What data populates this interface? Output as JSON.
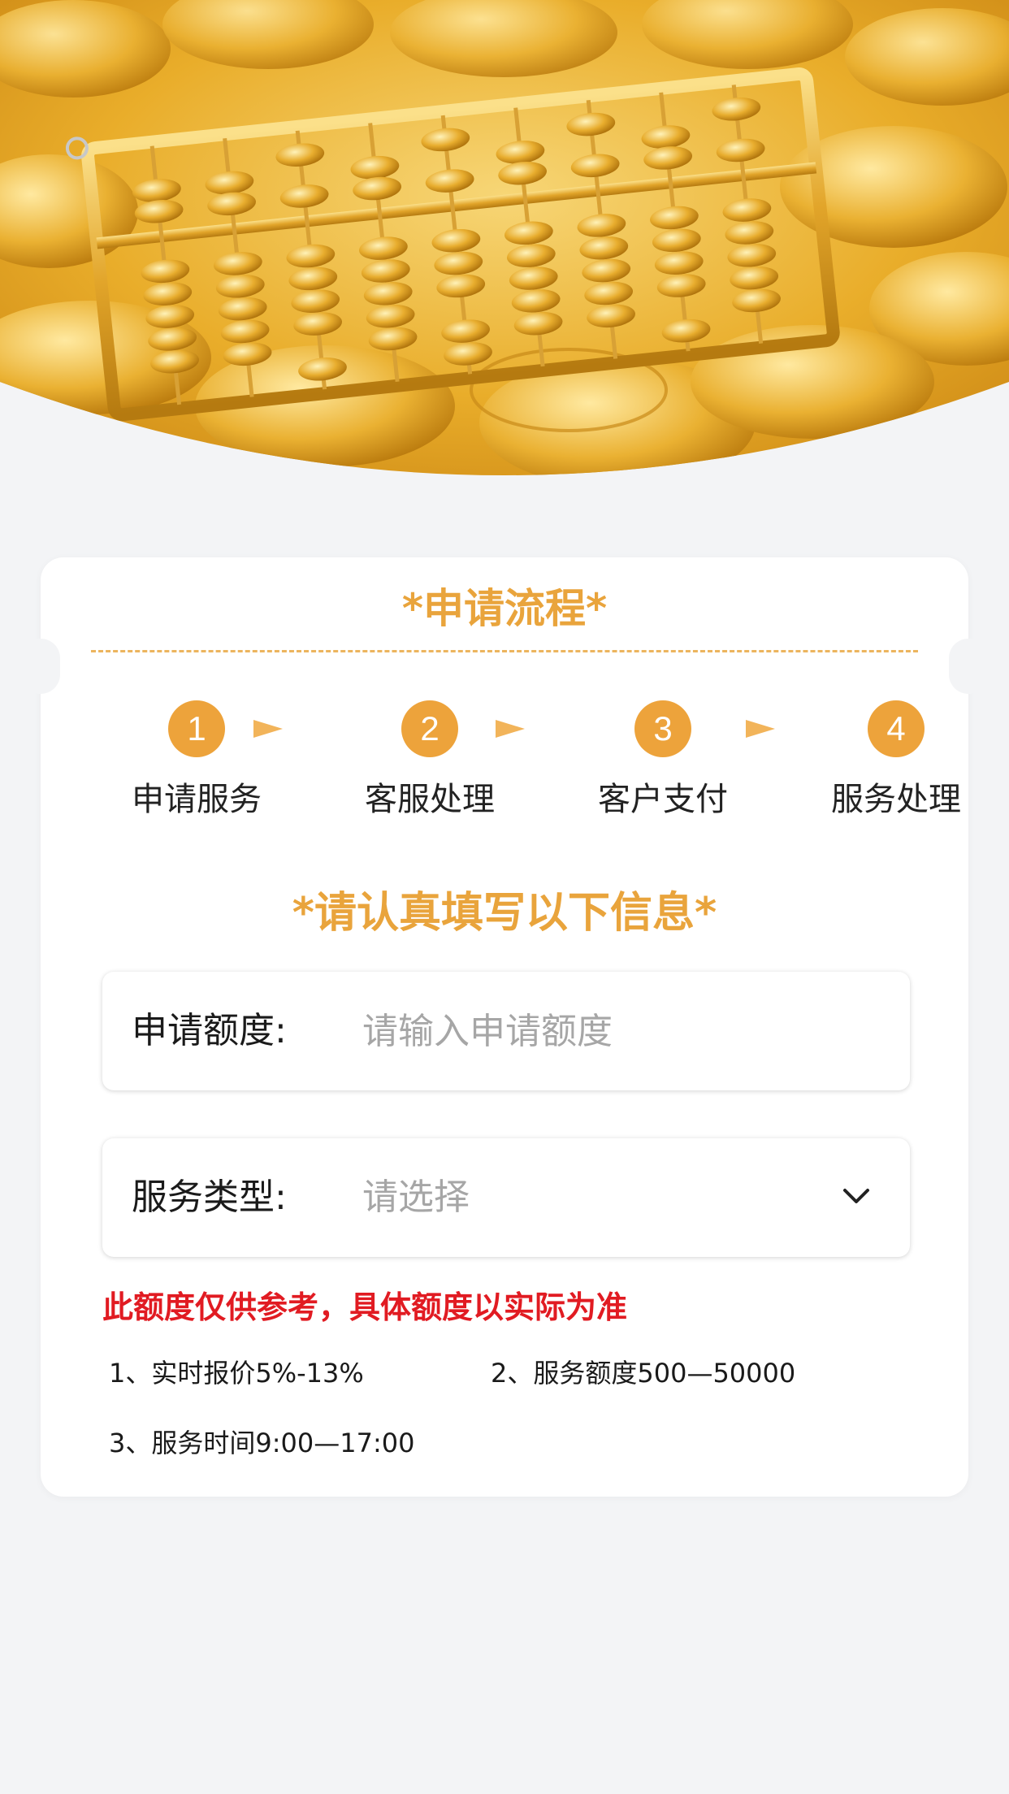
{
  "process": {
    "title": "*申请流程*",
    "steps": [
      {
        "number": "1",
        "label": "申请服务"
      },
      {
        "number": "2",
        "label": "客服处理"
      },
      {
        "number": "3",
        "label": "客户支付"
      },
      {
        "number": "4",
        "label": "服务处理"
      }
    ]
  },
  "form": {
    "title": "*请认真填写以下信息*",
    "amount": {
      "label": "申请额度:",
      "placeholder": "请输入申请额度",
      "value": ""
    },
    "service_type": {
      "label": "服务类型:",
      "placeholder": "请选择"
    }
  },
  "notice": "此额度仅供参考，具体额度以实际为准",
  "info": [
    "1、实时报价5%-13%",
    "2、服务额度500—50000",
    "3、服务时间9:00—17:00"
  ],
  "colors": {
    "accent": "#e9a43c",
    "step_circle": "#eda33b",
    "notice": "#e11b22",
    "background": "#f3f4f6"
  },
  "icons": {
    "step_arrow": "triangle-arrow-icon",
    "select": "chevron-down-icon"
  }
}
